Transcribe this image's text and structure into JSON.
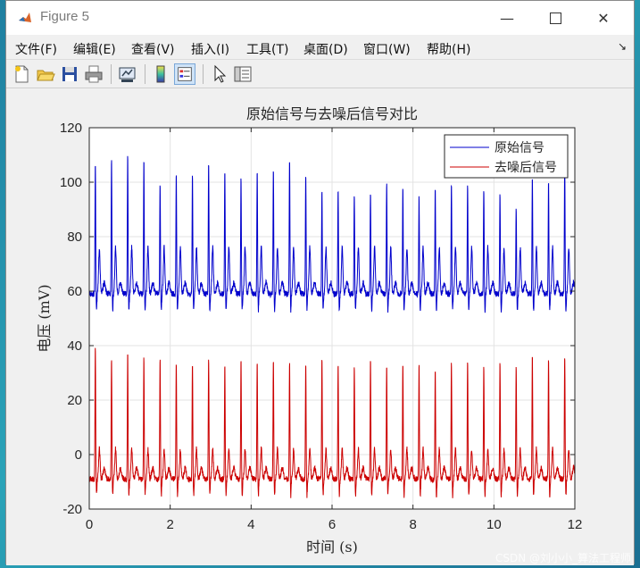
{
  "window": {
    "title": "Figure 5"
  },
  "menu": {
    "items": [
      "文件(F)",
      "编辑(E)",
      "查看(V)",
      "插入(I)",
      "工具(T)",
      "桌面(D)",
      "窗口(W)",
      "帮助(H)"
    ]
  },
  "toolbar": {
    "buttons": [
      "new-figure-icon",
      "open-file-icon",
      "save-icon",
      "print-icon",
      "link-icon",
      "colorbar-icon",
      "legend-icon",
      "pointer-icon",
      "property-inspector-icon"
    ]
  },
  "watermark": "CSDN @刘小小_算法工程师",
  "chart_data": {
    "type": "line",
    "title": "原始信号与去噪后信号对比",
    "xlabel": "时间 (s)",
    "ylabel": "电压 (mV)",
    "xlim": [
      0,
      12
    ],
    "ylim": [
      -20,
      120
    ],
    "xticks": [
      "0",
      "2",
      "4",
      "6",
      "8",
      "10",
      "12"
    ],
    "yticks": [
      "-20",
      "0",
      "20",
      "40",
      "60",
      "80",
      "100",
      "120"
    ],
    "grid": true,
    "legend_position": "top-right",
    "series": [
      {
        "name": "原始信号",
        "color": "#0000cc",
        "beat_times": [
          0.15,
          0.55,
          0.95,
          1.35,
          1.75,
          2.15,
          2.55,
          2.95,
          3.35,
          3.75,
          4.15,
          4.55,
          4.95,
          5.35,
          5.75,
          6.15,
          6.55,
          6.95,
          7.35,
          7.75,
          8.15,
          8.55,
          8.95,
          9.35,
          9.75,
          10.15,
          10.55,
          10.95,
          11.35,
          11.75
        ],
        "peak_values": [
          108,
          109,
          110,
          108,
          100,
          103,
          103,
          107,
          105,
          102,
          104,
          105,
          109,
          103,
          97,
          98,
          96,
          97,
          100,
          98,
          95,
          98,
          100,
          99,
          98,
          96,
          90,
          103,
          100,
          108
        ],
        "baseline": 59,
        "secondary_peak": 76
      },
      {
        "name": "去噪后信号",
        "color": "#cc0000",
        "beat_times": [
          0.15,
          0.55,
          0.95,
          1.35,
          1.75,
          2.15,
          2.55,
          2.95,
          3.35,
          3.75,
          4.15,
          4.55,
          4.95,
          5.35,
          5.75,
          6.15,
          6.55,
          6.95,
          7.35,
          7.75,
          8.15,
          8.55,
          8.95,
          9.35,
          9.75,
          10.15,
          10.55,
          10.95,
          11.35,
          11.75
        ],
        "peak_values": [
          40,
          35,
          37,
          36,
          35,
          34,
          34,
          35,
          33,
          35,
          34,
          35,
          34,
          33,
          35,
          34,
          33,
          35,
          32,
          34,
          33,
          32,
          34,
          34,
          33,
          34,
          33,
          36,
          35,
          37
        ],
        "baseline": -9,
        "secondary_peak": 2
      }
    ]
  }
}
